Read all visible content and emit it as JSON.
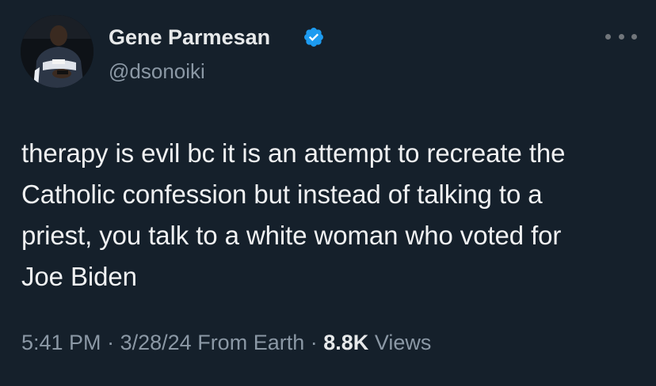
{
  "author": {
    "display_name": "Gene Parmesan",
    "handle": "@dsonoiki",
    "verified": true,
    "badge_color": "#1d9bf0"
  },
  "tweet": {
    "text": "therapy is evil bc it is an attempt to recreate the\nCatholic confession but instead of talking to a\npriest, you talk to a white woman who voted for\nJoe Biden"
  },
  "meta": {
    "time": "5:41 PM",
    "separator": "·",
    "date": "3/28/24",
    "source": "From Earth",
    "views_count": "8.8K",
    "views_label": "Views"
  },
  "icons": {
    "verified": "verified-badge-icon",
    "more": "more-options-icon"
  },
  "colors": {
    "background": "#15202b",
    "primary_text": "#e7e9ea",
    "secondary_text": "#8b98a5"
  }
}
